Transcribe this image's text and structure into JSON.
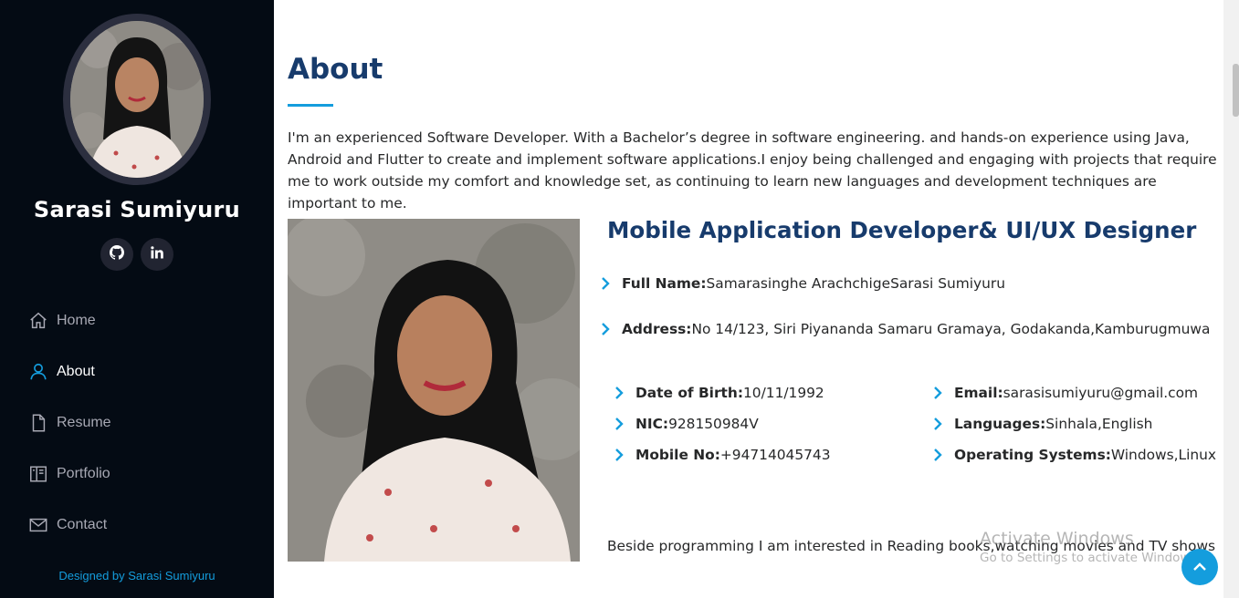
{
  "sidebar": {
    "name": "Sarasi Sumiyuru",
    "socials": [
      {
        "icon": "github-icon"
      },
      {
        "icon": "linkedin-icon"
      }
    ],
    "nav": [
      {
        "label": "Home",
        "icon": "home-icon"
      },
      {
        "label": "About",
        "icon": "user-icon",
        "active": true
      },
      {
        "label": "Resume",
        "icon": "file-icon"
      },
      {
        "label": "Portfolio",
        "icon": "portfolio-icon"
      },
      {
        "label": "Contact",
        "icon": "envelope-icon"
      }
    ],
    "credits": "Designed by Sarasi Sumiyuru"
  },
  "about": {
    "title": "About",
    "intro": "I'm an experienced Software Developer. With a Bachelor’s degree in software engineering. and hands-on experience using Java, Android and Flutter to create and implement software applications.I enjoy being challenged and engaging with projects that require me to work outside my comfort and knowledge set, as continuing to learn new languages and development techniques are important to me.",
    "role": "Mobile Application Developer& UI/UX Designer",
    "full_name": {
      "label": "Full Name:",
      "value": "Samarasinghe ArachchigeSarasi Sumiyuru"
    },
    "address": {
      "label": "Address:",
      "value": "No 14/123, Siri Piyananda Samaru Gramaya, Godakanda,Kamburugmuwa"
    },
    "left_details": [
      {
        "label": "Date of Birth:",
        "value": " 10/11/1992"
      },
      {
        "label": "NIC:",
        "value": "928150984V"
      },
      {
        "label": "Mobile No:",
        "value": "+94714045743"
      }
    ],
    "right_details": [
      {
        "label": "Email:",
        "value": " sarasisumiyuru@gmail.com"
      },
      {
        "label": "Languages:",
        "value": "Sinhala,English"
      },
      {
        "label": "Operating Systems:",
        "value": " Windows,Linux"
      }
    ],
    "hobbies": "Beside programming I am interested in Reading books,watching movies and TV shows"
  },
  "watermark": {
    "line1": "Activate Windows",
    "line2": "Go to Settings to activate Windows."
  },
  "colors": {
    "sidebar_bg": "#040b14",
    "accent": "#149ddd",
    "heading": "#173b6c"
  }
}
